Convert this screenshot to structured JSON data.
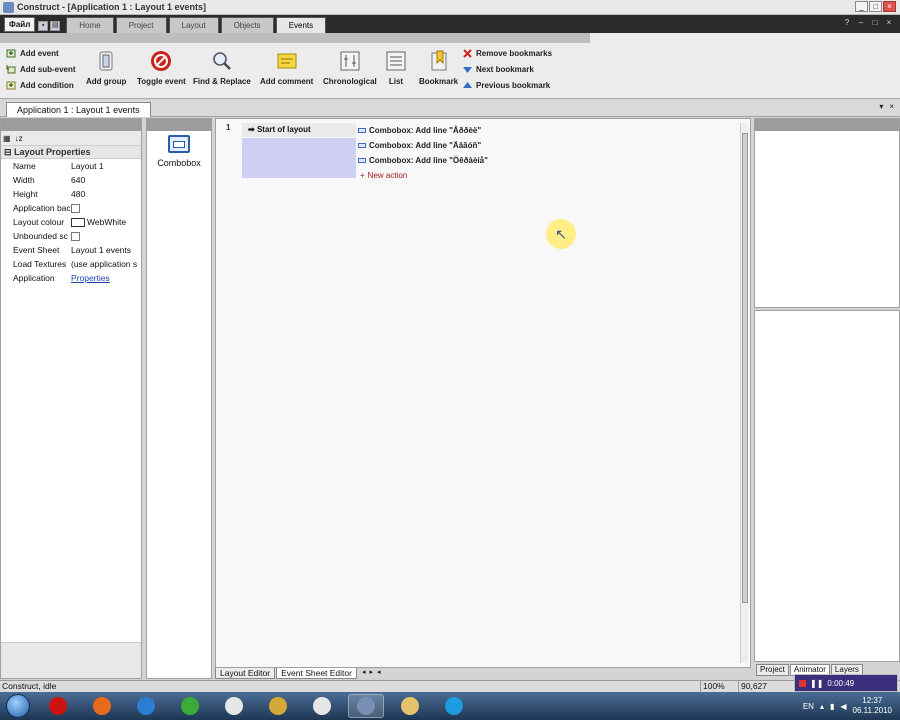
{
  "window": {
    "title": "Construct - [Application 1 : Layout 1 events]",
    "controls": [
      "_",
      "□",
      "×"
    ]
  },
  "quick_access": {
    "file_label": "Файл"
  },
  "ribbon_tabs": [
    {
      "label": "Home",
      "active": false
    },
    {
      "label": "Project",
      "active": false
    },
    {
      "label": "Layout",
      "active": false
    },
    {
      "label": "Objects",
      "active": false
    },
    {
      "label": "Events",
      "active": true
    }
  ],
  "ribbon": {
    "event_actions": [
      {
        "label": "Add event",
        "icon": "add-event-icon"
      },
      {
        "label": "Add sub-event",
        "icon": "add-sub-event-icon"
      },
      {
        "label": "Add condition",
        "icon": "add-condition-icon"
      }
    ],
    "buttons": [
      {
        "label": "Add group",
        "icon": "add-group-icon"
      },
      {
        "label": "Toggle event",
        "icon": "toggle-event-icon"
      },
      {
        "label": "Find & Replace",
        "icon": "magnifier-icon"
      },
      {
        "label": "Add comment",
        "icon": "note-icon"
      },
      {
        "label": "Chronological",
        "icon": "chronological-icon"
      },
      {
        "label": "List",
        "icon": "list-icon"
      },
      {
        "label": "Bookmark",
        "icon": "bookmark-icon"
      }
    ],
    "bookmark_actions": [
      {
        "label": "Remove bookmarks",
        "icon": "remove-bookmarks-icon"
      },
      {
        "label": "Next bookmark",
        "icon": "next-bookmark-icon"
      },
      {
        "label": "Previous bookmark",
        "icon": "previous-bookmark-icon"
      }
    ]
  },
  "document_tab": {
    "label": "Application 1 : Layout 1 events"
  },
  "properties": {
    "section_title": "Layout Properties",
    "rows": [
      {
        "name": "Name",
        "value": "Layout 1"
      },
      {
        "name": "Width",
        "value": "640"
      },
      {
        "name": "Height",
        "value": "480"
      },
      {
        "name": "Application bac",
        "value": "",
        "type": "checkbox"
      },
      {
        "name": "Layout colour",
        "value": "WebWhite",
        "type": "color"
      },
      {
        "name": "Unbounded sc",
        "value": "",
        "type": "checkbox"
      },
      {
        "name": "Event Sheet",
        "value": "Layout 1 events"
      },
      {
        "name": "Load Textures",
        "value": "(use application s"
      },
      {
        "name": "Application",
        "value": "Properties",
        "type": "link"
      }
    ]
  },
  "objects": {
    "items": [
      {
        "label": "Combobox"
      }
    ]
  },
  "event_sheet": {
    "event_number": "1",
    "condition": "Start of layout",
    "actions": [
      "Combobox: Add line \"Åððèë\"",
      "Combobox: Add line \"Äâãóñ\"",
      "Combobox: Add line \"Öêðàèíå\""
    ],
    "new_action_label": "New action"
  },
  "bottom_tabs": [
    {
      "label": "Layout Editor",
      "active": false
    },
    {
      "label": "Event Sheet Editor",
      "active": true
    }
  ],
  "right_tabs": [
    {
      "label": "Project",
      "active": false
    },
    {
      "label": "Animator",
      "active": true
    },
    {
      "label": "Layers",
      "active": false
    }
  ],
  "status": {
    "text": "Construct, idle",
    "zoom": "100%",
    "coords": "90,627"
  },
  "recorder": {
    "time": "0:00:49"
  },
  "taskbar": {
    "apps": [
      {
        "name": "opera-icon",
        "color": "#cc1111"
      },
      {
        "name": "firefox-icon",
        "color": "#e86a1b"
      },
      {
        "name": "ie-icon",
        "color": "#2a7fd4"
      },
      {
        "name": "chrome-icon",
        "color": "#3cab3a"
      },
      {
        "name": "media-player-icon",
        "color": "#e7e7e7"
      },
      {
        "name": "paint-icon",
        "color": "#d6a83a"
      },
      {
        "name": "notepad-icon",
        "color": "#e6e6e6"
      },
      {
        "name": "construct-icon",
        "color": "#7a8fb4",
        "open": true
      },
      {
        "name": "explorer-icon",
        "color": "#e4c36a"
      },
      {
        "name": "skype-icon",
        "color": "#1d9ce0"
      }
    ],
    "tray_lang": "EN",
    "time": "12:37",
    "date": "06.11.2010"
  },
  "colors": {
    "ribbon_dark": "#2b2b2b",
    "condition_fill": "#cfcff5",
    "new_action": "#a31c1c",
    "link": "#1a3fb0"
  }
}
